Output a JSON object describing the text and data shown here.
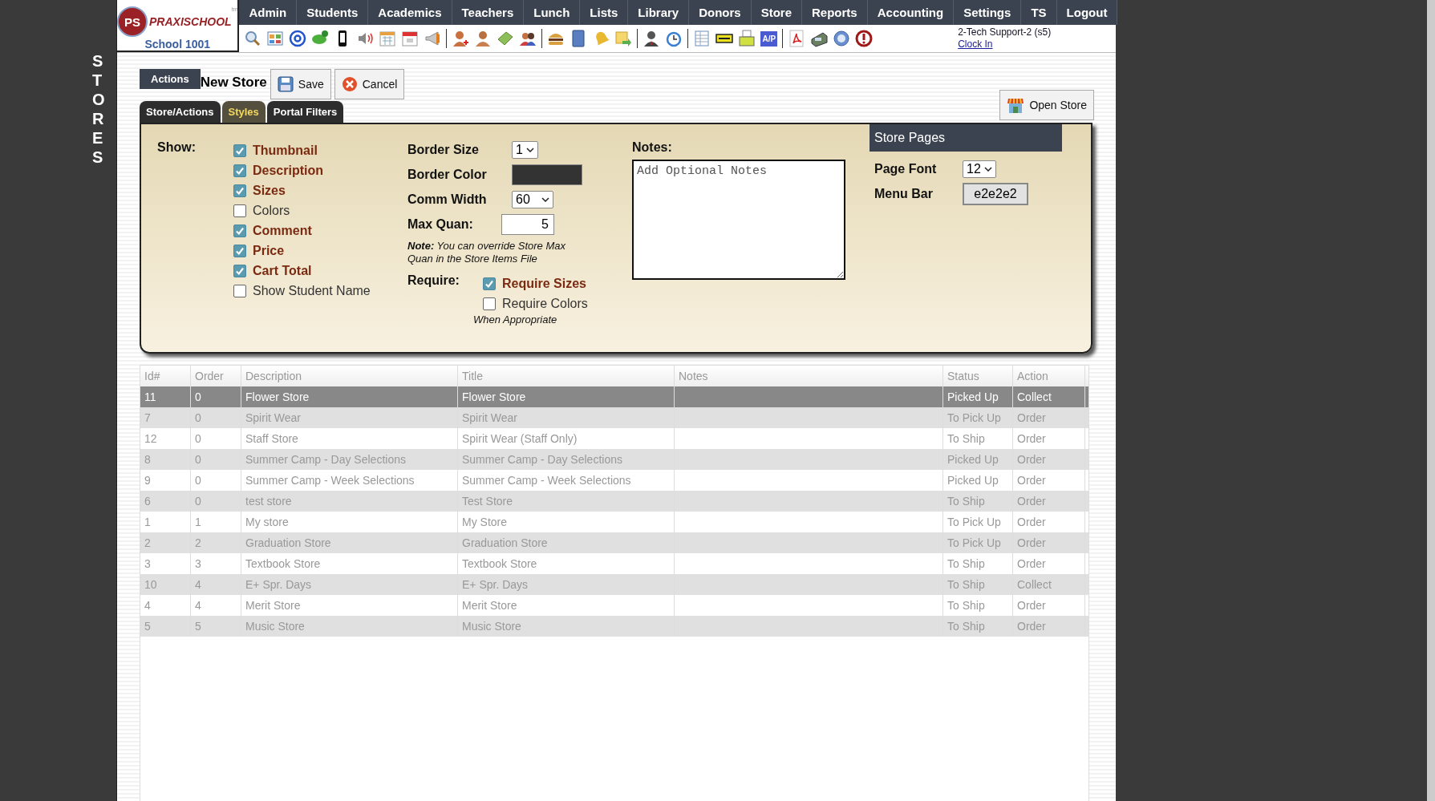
{
  "side_title": "STORES",
  "logo": {
    "monogram": "PS",
    "brand": "PRAXISCHOOL",
    "tm": "tm",
    "school": "School 1001"
  },
  "menu": [
    "Admin",
    "Students",
    "Academics",
    "Teachers",
    "Lunch",
    "Lists",
    "Library",
    "Donors",
    "Store",
    "Reports",
    "Accounting",
    "Settings",
    "TS",
    "Logout"
  ],
  "toolbar": {
    "ap_label": "A/P"
  },
  "user": {
    "name": "2-Tech Support-2 (s5)",
    "clock_link": "Clock In"
  },
  "actions": {
    "label": "Actions",
    "title": "New Store",
    "save": "Save",
    "cancel": "Cancel",
    "open_store": "Open Store"
  },
  "tabs": [
    {
      "label": "Store/Actions",
      "selected": false
    },
    {
      "label": "Styles",
      "selected": true
    },
    {
      "label": "Portal Filters",
      "selected": false
    }
  ],
  "show": {
    "label": "Show:",
    "options": [
      {
        "label": "Thumbnail",
        "checked": true
      },
      {
        "label": "Description",
        "checked": true
      },
      {
        "label": "Sizes",
        "checked": true
      },
      {
        "label": "Colors",
        "checked": false
      },
      {
        "label": "Comment",
        "checked": true
      },
      {
        "label": "Price",
        "checked": true
      },
      {
        "label": "Cart Total",
        "checked": true
      },
      {
        "label": "Show Student Name",
        "checked": false
      }
    ]
  },
  "border_size": {
    "label": "Border Size",
    "value": "1"
  },
  "border_color": {
    "label": "Border Color"
  },
  "comm_width": {
    "label": "Comm Width",
    "value": "60"
  },
  "max_quan": {
    "label": "Max Quan:",
    "value": "5"
  },
  "note": "**Note:** You can override Store Max Quan in the Store Items File",
  "require": {
    "label": "Require:",
    "options": [
      {
        "label": "Require Sizes",
        "checked": true
      },
      {
        "label": "Require Colors",
        "checked": false
      }
    ],
    "hint": "When Appropriate"
  },
  "notes": {
    "label": "Notes:",
    "value": "Add Optional Notes"
  },
  "store_pages": {
    "title": "Store Pages",
    "page_font": {
      "label": "Page Font",
      "value": "12"
    },
    "menu_bar": {
      "label": "Menu Bar",
      "value": "e2e2e2"
    }
  },
  "table": {
    "columns": [
      "Id#",
      "Order",
      "Description",
      "Title",
      "Notes",
      "Status",
      "Action"
    ],
    "rows": [
      {
        "cells": [
          "11",
          "0",
          "Flower Store",
          "Flower Store",
          "",
          "Picked Up",
          "Collect"
        ],
        "selected": true
      },
      {
        "cells": [
          "7",
          "0",
          "Spirit Wear",
          "Spirit Wear",
          "",
          "To Pick Up",
          "Order"
        ],
        "selected": false
      },
      {
        "cells": [
          "12",
          "0",
          "Staff Store",
          "Spirit Wear (Staff Only)",
          "",
          "To Ship",
          "Order"
        ],
        "selected": false
      },
      {
        "cells": [
          "8",
          "0",
          "Summer Camp - Day Selections",
          "Summer Camp - Day Selections",
          "",
          "Picked Up",
          "Order"
        ],
        "selected": false
      },
      {
        "cells": [
          "9",
          "0",
          "Summer Camp - Week Selections",
          "Summer Camp - Week Selections",
          "",
          "Picked Up",
          "Order"
        ],
        "selected": false
      },
      {
        "cells": [
          "6",
          "0",
          "test store",
          "Test Store",
          "",
          "To Ship",
          "Order"
        ],
        "selected": false
      },
      {
        "cells": [
          "1",
          "1",
          "My store",
          "My Store",
          "",
          "To Pick Up",
          "Order"
        ],
        "selected": false
      },
      {
        "cells": [
          "2",
          "2",
          "Graduation Store",
          "Graduation Store",
          "",
          "To Pick Up",
          "Order"
        ],
        "selected": false
      },
      {
        "cells": [
          "3",
          "3",
          "Textbook Store",
          "Textbook Store",
          "",
          "To Ship",
          "Order"
        ],
        "selected": false
      },
      {
        "cells": [
          "10",
          "4",
          "E+ Spr. Days",
          "E+ Spr. Days",
          "",
          "To Ship",
          "Collect"
        ],
        "selected": false
      },
      {
        "cells": [
          "4",
          "4",
          "Merit Store",
          "Merit Store",
          "",
          "To Ship",
          "Order"
        ],
        "selected": false
      },
      {
        "cells": [
          "5",
          "5",
          "Music Store",
          "Music Store",
          "",
          "To Ship",
          "Order"
        ],
        "selected": false
      }
    ]
  }
}
